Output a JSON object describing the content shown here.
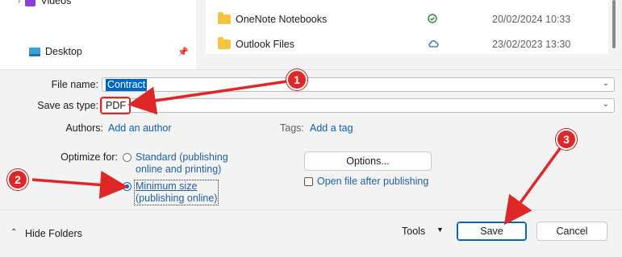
{
  "nav": {
    "videos_label": "Videos",
    "desktop_label": "Desktop"
  },
  "files": [
    {
      "name": "OneNote Notebooks",
      "status": "check-circle-icon",
      "date": "20/02/2024 10:33"
    },
    {
      "name": "Outlook Files",
      "status": "cloud-icon",
      "date": "23/02/2023 13:30"
    }
  ],
  "form": {
    "file_name_label": "File name:",
    "file_name_value": "Contract",
    "save_type_label": "Save as type:",
    "save_type_value": "PDF",
    "authors_label": "Authors:",
    "authors_link": "Add an author",
    "tags_label": "Tags:",
    "tags_link": "Add a tag",
    "optimize_label": "Optimize for:",
    "opt_standard": "Standard (publishing online and printing)",
    "opt_standard_l1": "Standard (publishing",
    "opt_standard_l2": "online and printing)",
    "opt_min_l1": "Minimum size",
    "opt_min_l2": "(publishing online)",
    "selected_option": "Minimum size (publishing online)",
    "options_button": "Options...",
    "open_after_label": "Open file after publishing",
    "open_after_checked": false
  },
  "footer": {
    "hide_folders": "Hide Folders",
    "tools": "Tools",
    "save": "Save",
    "cancel": "Cancel"
  },
  "annotations": [
    "1",
    "2",
    "3"
  ],
  "colors": {
    "accent": "#0067c0",
    "annotation_red": "#e02727",
    "link": "#0a5fb4",
    "folder": "#f5c541"
  }
}
